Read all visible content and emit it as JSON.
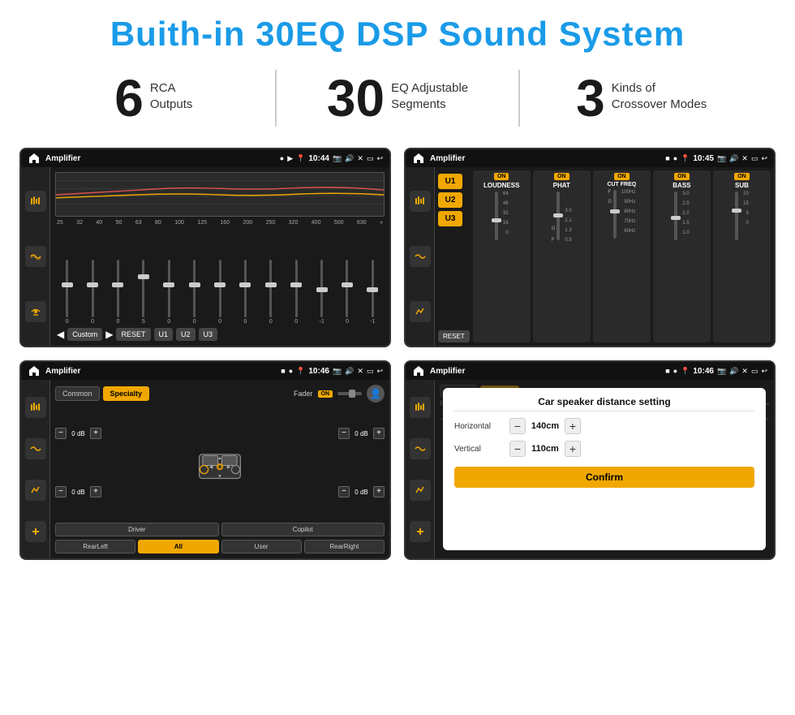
{
  "header": {
    "title": "Buith-in 30EQ DSP Sound System"
  },
  "stats": [
    {
      "number": "6",
      "label": "RCA\nOutputs"
    },
    {
      "number": "30",
      "label": "EQ Adjustable\nSegments"
    },
    {
      "number": "3",
      "label": "Kinds of\nCrossover Modes"
    }
  ],
  "screen_tl": {
    "title": "Amplifier",
    "time": "10:44",
    "freq_labels": [
      "25",
      "32",
      "40",
      "50",
      "63",
      "80",
      "100",
      "125",
      "160",
      "200",
      "250",
      "320",
      "400",
      "500",
      "630"
    ],
    "slider_values": [
      "0",
      "0",
      "0",
      "5",
      "0",
      "0",
      "0",
      "0",
      "0",
      "0",
      "-1",
      "0",
      "-1"
    ],
    "bottom_buttons": [
      "Custom",
      "RESET",
      "U1",
      "U2",
      "U3"
    ]
  },
  "screen_tr": {
    "title": "Amplifier",
    "time": "10:45",
    "u_buttons": [
      "U1",
      "U2",
      "U3"
    ],
    "channels": [
      {
        "name": "LOUDNESS",
        "on": true
      },
      {
        "name": "PHAT",
        "on": true
      },
      {
        "name": "CUT FREQ",
        "on": true
      },
      {
        "name": "BASS",
        "on": true
      },
      {
        "name": "SUB",
        "on": true
      }
    ],
    "reset_label": "RESET"
  },
  "screen_bl": {
    "title": "Amplifier",
    "time": "10:46",
    "tabs": [
      "Common",
      "Specialty"
    ],
    "active_tab": "Specialty",
    "fader_label": "Fader",
    "fader_on": "ON",
    "speaker_controls": {
      "fl": "0 dB",
      "fr": "0 dB",
      "rl": "0 dB",
      "rr": "0 dB"
    },
    "bottom_buttons": [
      "Driver",
      "",
      "Copilot",
      "RearLeft",
      "All",
      "",
      "User",
      "RearRight"
    ]
  },
  "screen_br": {
    "title": "Amplifier",
    "time": "10:46",
    "tabs": [
      "Common",
      "Specialty"
    ],
    "dialog": {
      "title": "Car speaker distance setting",
      "horizontal_label": "Horizontal",
      "horizontal_value": "140cm",
      "vertical_label": "Vertical",
      "vertical_value": "110cm",
      "confirm_label": "Confirm"
    }
  },
  "icons": {
    "home": "⌂",
    "back": "↩",
    "location": "📍",
    "camera": "📷",
    "volume": "🔊",
    "close": "✕",
    "window": "▭",
    "eq_icon": "≡",
    "wave_icon": "〜",
    "speaker_icon": "🔈",
    "expand_icon": "⤢",
    "user_icon": "👤",
    "chevron_left": "◀",
    "chevron_right": "▶",
    "more": "»"
  }
}
